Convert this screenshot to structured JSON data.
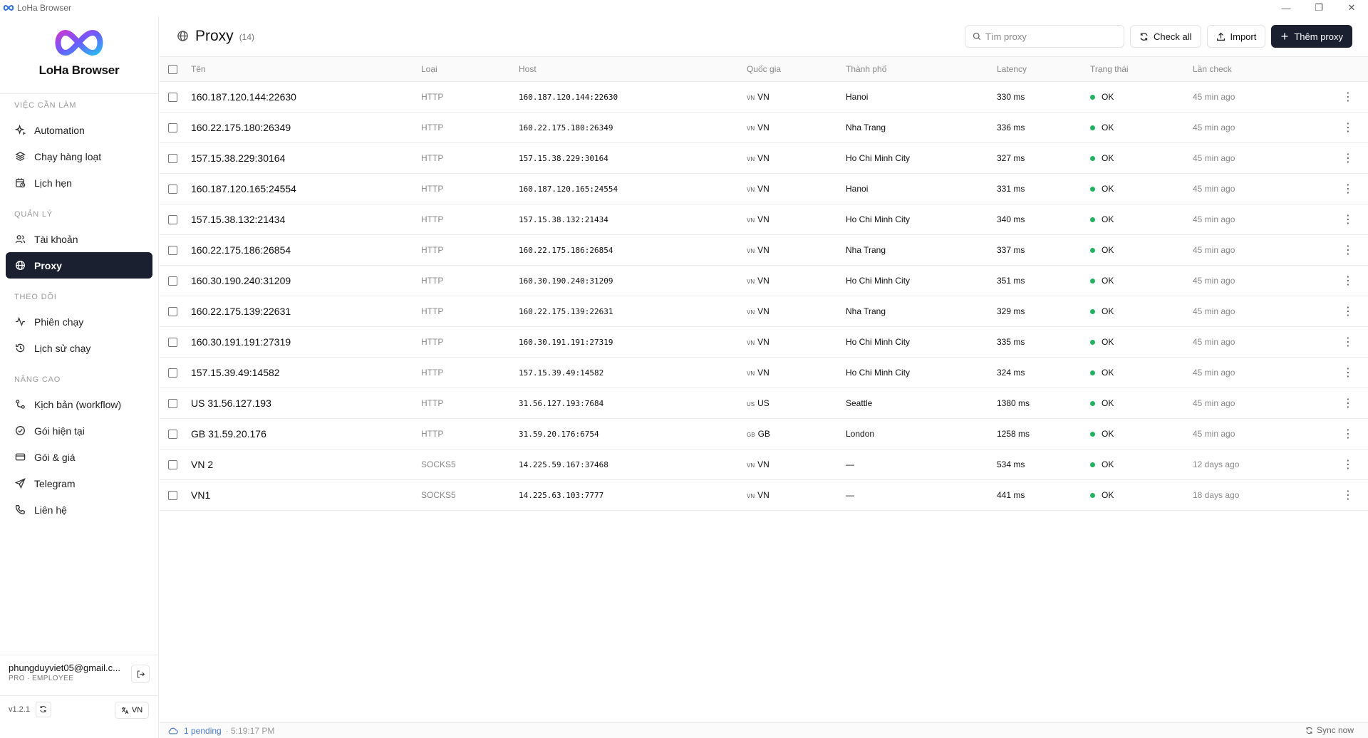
{
  "window": {
    "title": "LoHa Browser",
    "controls": [
      "—",
      "❐",
      "✕"
    ]
  },
  "sidebar": {
    "brand": "LoHa Browser",
    "sections": [
      {
        "label": "VIỆC CẦN LÀM",
        "items": [
          {
            "label": "Automation",
            "icon": "sparkles-icon"
          },
          {
            "label": "Chạy hàng loạt",
            "icon": "layers-icon"
          },
          {
            "label": "Lịch hẹn",
            "icon": "calendar-clock-icon"
          }
        ]
      },
      {
        "label": "QUẢN LÝ",
        "items": [
          {
            "label": "Tài khoản",
            "icon": "users-icon"
          },
          {
            "label": "Proxy",
            "icon": "globe-icon",
            "active": true
          }
        ]
      },
      {
        "label": "THEO DÕI",
        "items": [
          {
            "label": "Phiên chạy",
            "icon": "activity-icon"
          },
          {
            "label": "Lịch sử chạy",
            "icon": "history-icon"
          }
        ]
      },
      {
        "label": "NÂNG CAO",
        "items": [
          {
            "label": "Kịch bản (workflow)",
            "icon": "workflow-icon"
          },
          {
            "label": "Gói hiện tại",
            "icon": "check-circle-icon"
          },
          {
            "label": "Gói & giá",
            "icon": "credit-card-icon"
          },
          {
            "label": "Telegram",
            "icon": "send-icon"
          },
          {
            "label": "Liên hệ",
            "icon": "phone-icon"
          }
        ]
      }
    ],
    "user": {
      "email": "phungduyviet05@gmail.c...",
      "plan": "PRO · EMPLOYEE"
    },
    "version": "v1.2.1",
    "language": "VN"
  },
  "header": {
    "title": "Proxy",
    "count": "(14)",
    "search_placeholder": "Tìm proxy",
    "check_all_label": "Check all",
    "import_label": "Import",
    "add_label": "Thêm proxy"
  },
  "table": {
    "columns": [
      "Tên",
      "Loại",
      "Host",
      "Quốc gia",
      "Thành phố",
      "Latency",
      "Trạng thái",
      "Lần check"
    ],
    "rows": [
      {
        "name": "160.187.120.144:22630",
        "type": "HTTP",
        "host": "160.187.120.144:22630",
        "flag": "VN",
        "country": "VN",
        "city": "Hanoi",
        "latency": "330 ms",
        "status": "OK",
        "last": "45 min ago"
      },
      {
        "name": "160.22.175.180:26349",
        "type": "HTTP",
        "host": "160.22.175.180:26349",
        "flag": "VN",
        "country": "VN",
        "city": "Nha Trang",
        "latency": "336 ms",
        "status": "OK",
        "last": "45 min ago"
      },
      {
        "name": "157.15.38.229:30164",
        "type": "HTTP",
        "host": "157.15.38.229:30164",
        "flag": "VN",
        "country": "VN",
        "city": "Ho Chi Minh City",
        "latency": "327 ms",
        "status": "OK",
        "last": "45 min ago"
      },
      {
        "name": "160.187.120.165:24554",
        "type": "HTTP",
        "host": "160.187.120.165:24554",
        "flag": "VN",
        "country": "VN",
        "city": "Hanoi",
        "latency": "331 ms",
        "status": "OK",
        "last": "45 min ago"
      },
      {
        "name": "157.15.38.132:21434",
        "type": "HTTP",
        "host": "157.15.38.132:21434",
        "flag": "VN",
        "country": "VN",
        "city": "Ho Chi Minh City",
        "latency": "340 ms",
        "status": "OK",
        "last": "45 min ago"
      },
      {
        "name": "160.22.175.186:26854",
        "type": "HTTP",
        "host": "160.22.175.186:26854",
        "flag": "VN",
        "country": "VN",
        "city": "Nha Trang",
        "latency": "337 ms",
        "status": "OK",
        "last": "45 min ago"
      },
      {
        "name": "160.30.190.240:31209",
        "type": "HTTP",
        "host": "160.30.190.240:31209",
        "flag": "VN",
        "country": "VN",
        "city": "Ho Chi Minh City",
        "latency": "351 ms",
        "status": "OK",
        "last": "45 min ago"
      },
      {
        "name": "160.22.175.139:22631",
        "type": "HTTP",
        "host": "160.22.175.139:22631",
        "flag": "VN",
        "country": "VN",
        "city": "Nha Trang",
        "latency": "329 ms",
        "status": "OK",
        "last": "45 min ago"
      },
      {
        "name": "160.30.191.191:27319",
        "type": "HTTP",
        "host": "160.30.191.191:27319",
        "flag": "VN",
        "country": "VN",
        "city": "Ho Chi Minh City",
        "latency": "335 ms",
        "status": "OK",
        "last": "45 min ago"
      },
      {
        "name": "157.15.39.49:14582",
        "type": "HTTP",
        "host": "157.15.39.49:14582",
        "flag": "VN",
        "country": "VN",
        "city": "Ho Chi Minh City",
        "latency": "324 ms",
        "status": "OK",
        "last": "45 min ago"
      },
      {
        "name": "US 31.56.127.193",
        "type": "HTTP",
        "host": "31.56.127.193:7684",
        "flag": "US",
        "country": "US",
        "city": "Seattle",
        "latency": "1380 ms",
        "status": "OK",
        "last": "45 min ago"
      },
      {
        "name": "GB 31.59.20.176",
        "type": "HTTP",
        "host": "31.59.20.176:6754",
        "flag": "GB",
        "country": "GB",
        "city": "London",
        "latency": "1258 ms",
        "status": "OK",
        "last": "45 min ago"
      },
      {
        "name": "VN 2",
        "type": "SOCKS5",
        "host": "14.225.59.167:37468",
        "flag": "VN",
        "country": "VN",
        "city": "—",
        "latency": "534 ms",
        "status": "OK",
        "last": "12 days ago"
      },
      {
        "name": "VN1",
        "type": "SOCKS5",
        "host": "14.225.63.103:7777",
        "flag": "VN",
        "country": "VN",
        "city": "—",
        "latency": "441 ms",
        "status": "OK",
        "last": "18 days ago"
      }
    ]
  },
  "footer": {
    "pending": "1 pending",
    "time": "· 5:19:17 PM",
    "sync": "Sync now"
  },
  "colors": {
    "accent_dark": "#1b2030",
    "status_ok": "#22b35e",
    "pending": "#4a7cc7"
  }
}
